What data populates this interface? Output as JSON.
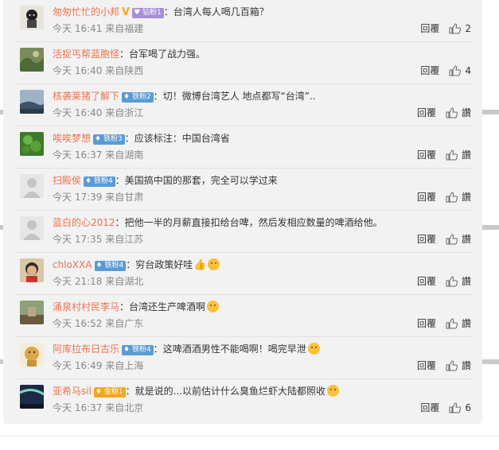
{
  "reply_label": "回覆",
  "comments": [
    {
      "user": "匆匆忙忙的小邦",
      "badge": {
        "text": "♥ 钻粉1",
        "style": "purple"
      },
      "verified": true,
      "text": "台湾人每人喝几百箱？",
      "emoji": "",
      "time": "今天 16:41 来自福建",
      "likes": "2"
    },
    {
      "user": "活捉丐帮蓝胞怪",
      "badge": null,
      "verified": false,
      "text": "台军喝了战力强。",
      "emoji": "",
      "time": "今天 16:40 来自陕西",
      "likes": "4"
    },
    {
      "user": "核袭莱猪了解下",
      "badge": {
        "text": "♦ 铁粉2",
        "style": "blue"
      },
      "verified": false,
      "text": "切！微博台湾艺人 地点都写“台湾”..",
      "emoji": "",
      "time": "今天 16:40 来自浙江",
      "likes": "讚"
    },
    {
      "user": "唉唉梦想",
      "badge": {
        "text": "♦ 铁粉3",
        "style": "blue"
      },
      "verified": false,
      "text": "应该标注：中国台湾省",
      "emoji": "",
      "time": "今天 16:37 来自湖南",
      "likes": "讚"
    },
    {
      "user": "扫殿侯",
      "badge": {
        "text": "♦ 铁粉4",
        "style": "blue"
      },
      "verified": false,
      "text": "美国搞中国的那套，完全可以学过来",
      "emoji": "",
      "time": "今天 17:39 来自甘肃",
      "likes": "讚"
    },
    {
      "user": "蓝白的心2012",
      "badge": null,
      "verified": false,
      "text": "把他一半的月薪直接扣给台啤，然后发相应数量的啤酒给他。",
      "emoji": "",
      "time": "今天 17:35 来自江苏",
      "likes": "讚"
    },
    {
      "user": "chloXXA",
      "badge": {
        "text": "♦ 铁粉4",
        "style": "blue"
      },
      "verified": false,
      "text": "穷台政策好哇",
      "emoji": "thumb",
      "time": "今天 21:18 来自湖北",
      "likes": "讚"
    },
    {
      "user": "涌泉村村民李马",
      "badge": null,
      "verified": false,
      "text": "台湾还生产啤酒啊",
      "emoji": "face",
      "time": "今天 16:52 来自广东",
      "likes": "讚"
    },
    {
      "user": "阿库拉布日古乐",
      "badge": {
        "text": "♦ 铁粉4",
        "style": "blue"
      },
      "verified": false,
      "text": "这啤酒酒男性不能喝啊！喝完早泄",
      "emoji": "face",
      "time": "今天 16:49 来自上海",
      "likes": "讚"
    },
    {
      "user": "亚希马sil",
      "badge": {
        "text": "♦ 金粉1",
        "style": "gold"
      },
      "verified": false,
      "text": "就是说的...以前估计什么臭鱼烂虾大陆都照收",
      "emoji": "face",
      "time": "今天 16:37 来自北京",
      "likes": "6"
    }
  ],
  "colors": {
    "username": "#eb7350",
    "meta": "#888888",
    "panel": "#f2f2f2"
  }
}
